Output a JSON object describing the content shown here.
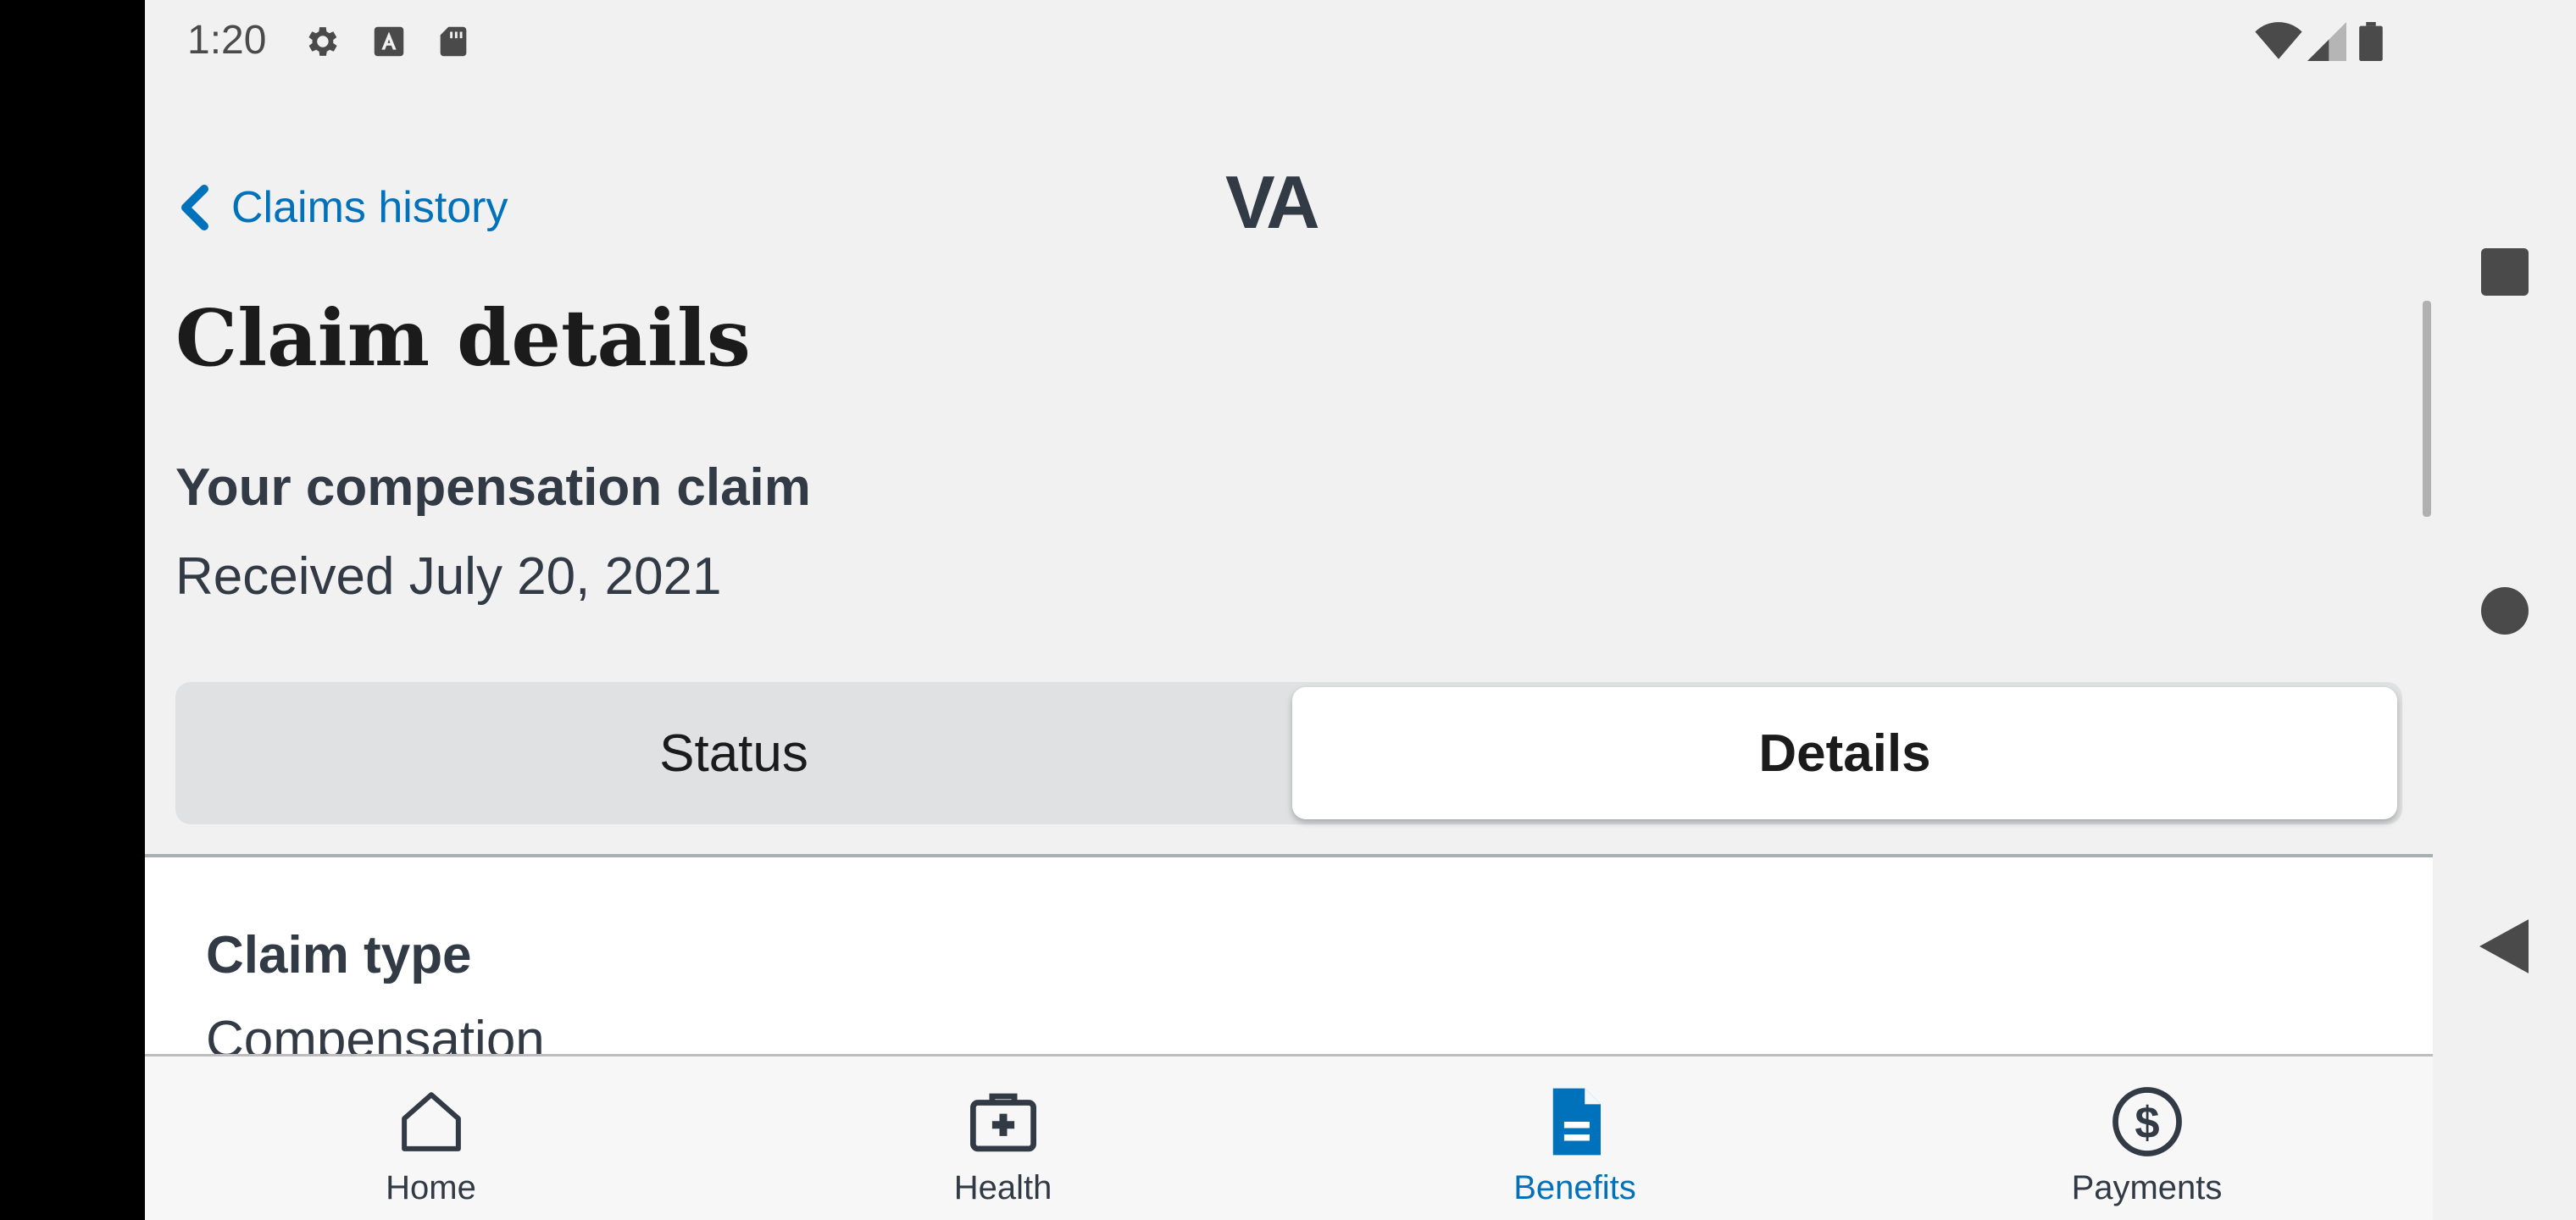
{
  "status_bar": {
    "time": "1:20",
    "left_icons": [
      "gear-icon",
      "font-a-icon",
      "sd-card-icon"
    ],
    "right_icons": [
      "wifi-icon",
      "signal-icon",
      "battery-icon"
    ]
  },
  "header": {
    "back_label": "Claims history",
    "logo": "VA"
  },
  "page": {
    "title": "Claim details",
    "claim_heading": "Your compensation claim",
    "received": "Received July 20, 2021"
  },
  "tabs_segmented": {
    "status": "Status",
    "details": "Details",
    "selected": "Details"
  },
  "details": {
    "claim_type_label": "Claim type",
    "claim_type_value": "Compensation"
  },
  "bottom_nav": [
    {
      "label": "Home",
      "icon": "home-icon"
    },
    {
      "label": "Health",
      "icon": "medical-kit-icon"
    },
    {
      "label": "Benefits",
      "icon": "document-icon",
      "active": true
    },
    {
      "label": "Payments",
      "icon": "dollar-circle-icon"
    }
  ],
  "colors": {
    "accent": "#0071bb",
    "text": "#323a45",
    "background": "#f1f1f1"
  }
}
